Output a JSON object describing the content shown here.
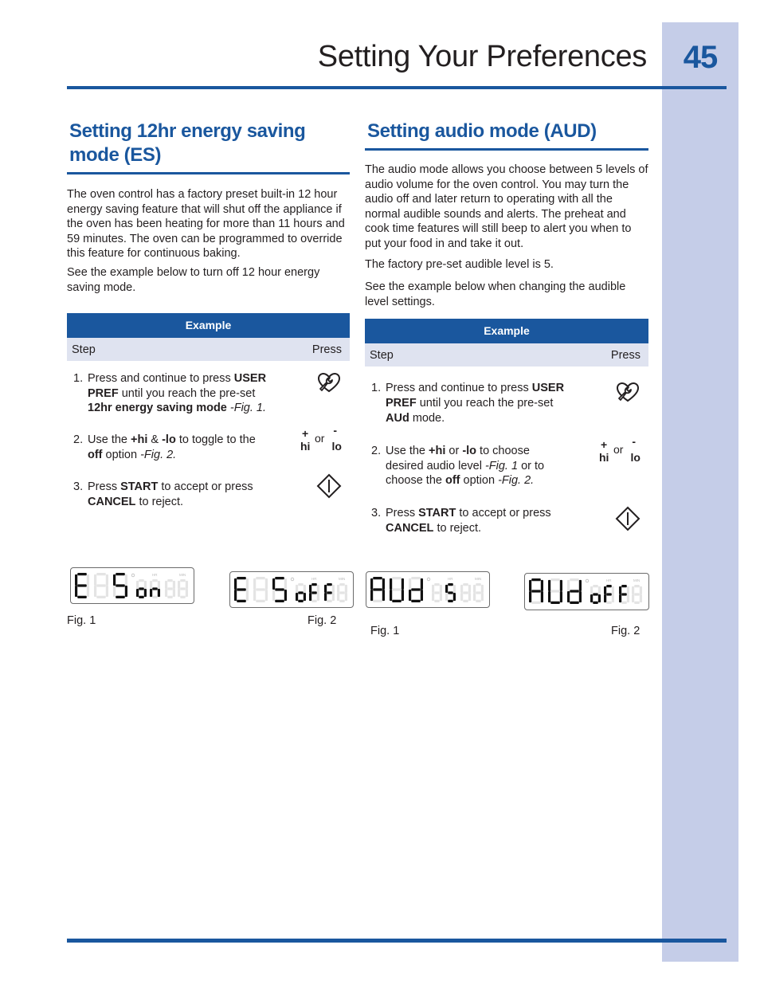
{
  "header": {
    "title": "Setting Your Preferences",
    "page_number": "45"
  },
  "colors": {
    "accent": "#1a579e",
    "tab": "#c5cde8",
    "table_subheader": "#dfe3f0",
    "text": "#231f20"
  },
  "es": {
    "heading": "Setting 12hr energy saving mode (ES)",
    "paragraphs": [
      "The oven control has a factory preset built-in 12 hour energy saving feature that will shut off the appliance if the oven has been heating  for more than 11 hours and 59 minutes. The oven can be programmed to override this feature for continuous baking.",
      "See the example below to turn off 12 hour energy saving mode."
    ],
    "example": {
      "title": "Example",
      "col_step": "Step",
      "col_press": "Press",
      "steps": [
        {
          "num": "1.",
          "parts": [
            [
              "Press and continue to press ",
              "n"
            ],
            [
              "USER PREF",
              "b"
            ],
            [
              " until you reach the pre-set ",
              "n"
            ],
            [
              "12hr energy saving mode",
              "b"
            ],
            [
              "  -Fig. 1.",
              "i"
            ]
          ],
          "press_icon": "user-pref-wrench-heart-icon"
        },
        {
          "num": "2.",
          "parts": [
            [
              "Use the ",
              "n"
            ],
            [
              "+hi",
              "b"
            ],
            [
              " & ",
              "n"
            ],
            [
              "-lo",
              "b"
            ],
            [
              " to toggle to the ",
              "n"
            ],
            [
              "off",
              "b"
            ],
            [
              " option  ",
              "n"
            ],
            [
              "-Fig. 2.",
              "i"
            ]
          ],
          "press_icon": "hi-lo-keys-icon"
        },
        {
          "num": "3.",
          "parts": [
            [
              "Press ",
              "n"
            ],
            [
              "START",
              "b"
            ],
            [
              " to accept or press ",
              "n"
            ],
            [
              "CANCEL",
              "b"
            ],
            [
              " to reject.",
              "n"
            ]
          ],
          "press_icon": "start-diamond-icon"
        }
      ]
    },
    "figures": [
      {
        "label": "Fig. 1",
        "display_main": "ES",
        "display_sub": "on"
      },
      {
        "label": "Fig. 2",
        "display_main": "ES",
        "display_sub": "oFF"
      }
    ]
  },
  "aud": {
    "heading": "Setting audio mode (AUD)",
    "paragraphs": [
      "The audio mode allows you choose between 5 levels of audio volume for the oven control. You may turn the audio off and later return to operating with all the normal audible sounds and alerts. The preheat and cook time features will still beep to alert you when to put your food in and take it out.",
      "The factory pre-set audible level is 5.",
      "See the example below when changing the audible level settings."
    ],
    "example": {
      "title": "Example",
      "col_step": "Step",
      "col_press": "Press",
      "steps": [
        {
          "num": "1.",
          "parts": [
            [
              "Press and continue to press ",
              "n"
            ],
            [
              "USER PREF",
              "b"
            ],
            [
              " until you reach the pre-set ",
              "n"
            ],
            [
              "AUd",
              "b"
            ],
            [
              " mode.",
              "n"
            ]
          ],
          "press_icon": "user-pref-wrench-heart-icon"
        },
        {
          "num": "2.",
          "parts": [
            [
              "Use the ",
              "n"
            ],
            [
              "+hi",
              "b"
            ],
            [
              " or ",
              "n"
            ],
            [
              "-lo",
              "b"
            ],
            [
              " to choose desired audio level ",
              "n"
            ],
            [
              "-Fig. 1",
              "i"
            ],
            [
              " or to choose the ",
              "n"
            ],
            [
              "off",
              "b"
            ],
            [
              " option ",
              "n"
            ],
            [
              "-Fig. 2.",
              "i"
            ]
          ],
          "press_icon": "hi-lo-keys-icon"
        },
        {
          "num": "3.",
          "parts": [
            [
              "Press ",
              "n"
            ],
            [
              "START",
              "b"
            ],
            [
              " to accept or press ",
              "n"
            ],
            [
              "CANCEL",
              "b"
            ],
            [
              " to reject.",
              "n"
            ]
          ],
          "press_icon": "start-diamond-icon"
        }
      ]
    },
    "figures": [
      {
        "label": "Fig. 1",
        "display_main": "AUd",
        "display_sub": "5"
      },
      {
        "label": "Fig. 2",
        "display_main": "AUd",
        "display_sub": "oFF"
      }
    ]
  },
  "keys": {
    "plus": "+",
    "minus": "-",
    "hi": "hi",
    "or": "or",
    "lo": "lo"
  },
  "lcd_labels": {
    "hr": "HR",
    "min": "MIN"
  }
}
